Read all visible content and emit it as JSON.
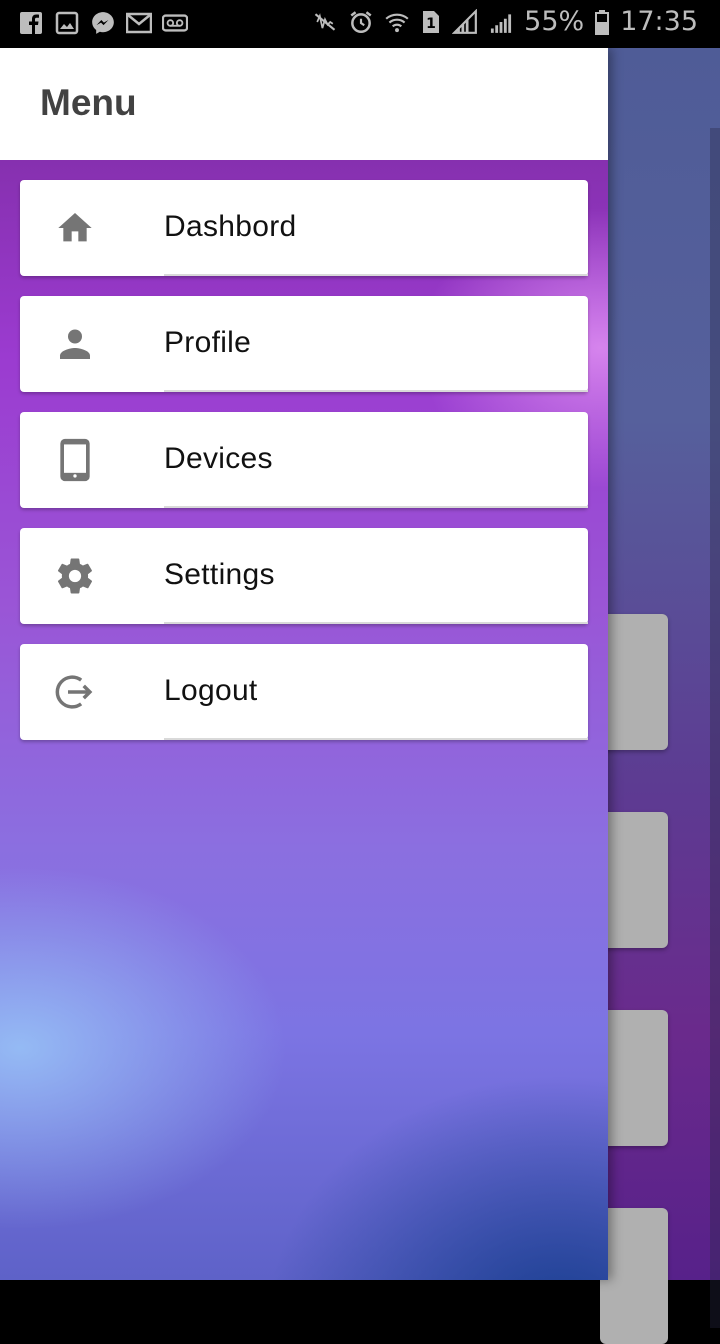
{
  "status_bar": {
    "battery": "55%",
    "time": "17:35",
    "sim": "1",
    "left_icons": [
      "facebook-icon",
      "gallery-icon",
      "messenger-icon",
      "gmail-icon",
      "voicemail-icon"
    ],
    "right_icons": [
      "mute-icon",
      "alarm-icon",
      "wifi-icon",
      "sim-icon",
      "signal-icon",
      "signal-icon",
      "battery-icon"
    ]
  },
  "drawer": {
    "title": "Menu",
    "items": [
      {
        "label": "Dashbord",
        "icon": "home-icon"
      },
      {
        "label": "Profile",
        "icon": "person-icon"
      },
      {
        "label": "Devices",
        "icon": "tablet-icon"
      },
      {
        "label": "Settings",
        "icon": "gear-icon"
      },
      {
        "label": "Logout",
        "icon": "logout-icon"
      }
    ]
  },
  "colors": {
    "icon": "#757575",
    "header_bg": "#ffffff",
    "drawer_gradient_top": "#7a2a9c",
    "drawer_gradient_bottom": "#5e62c8"
  }
}
